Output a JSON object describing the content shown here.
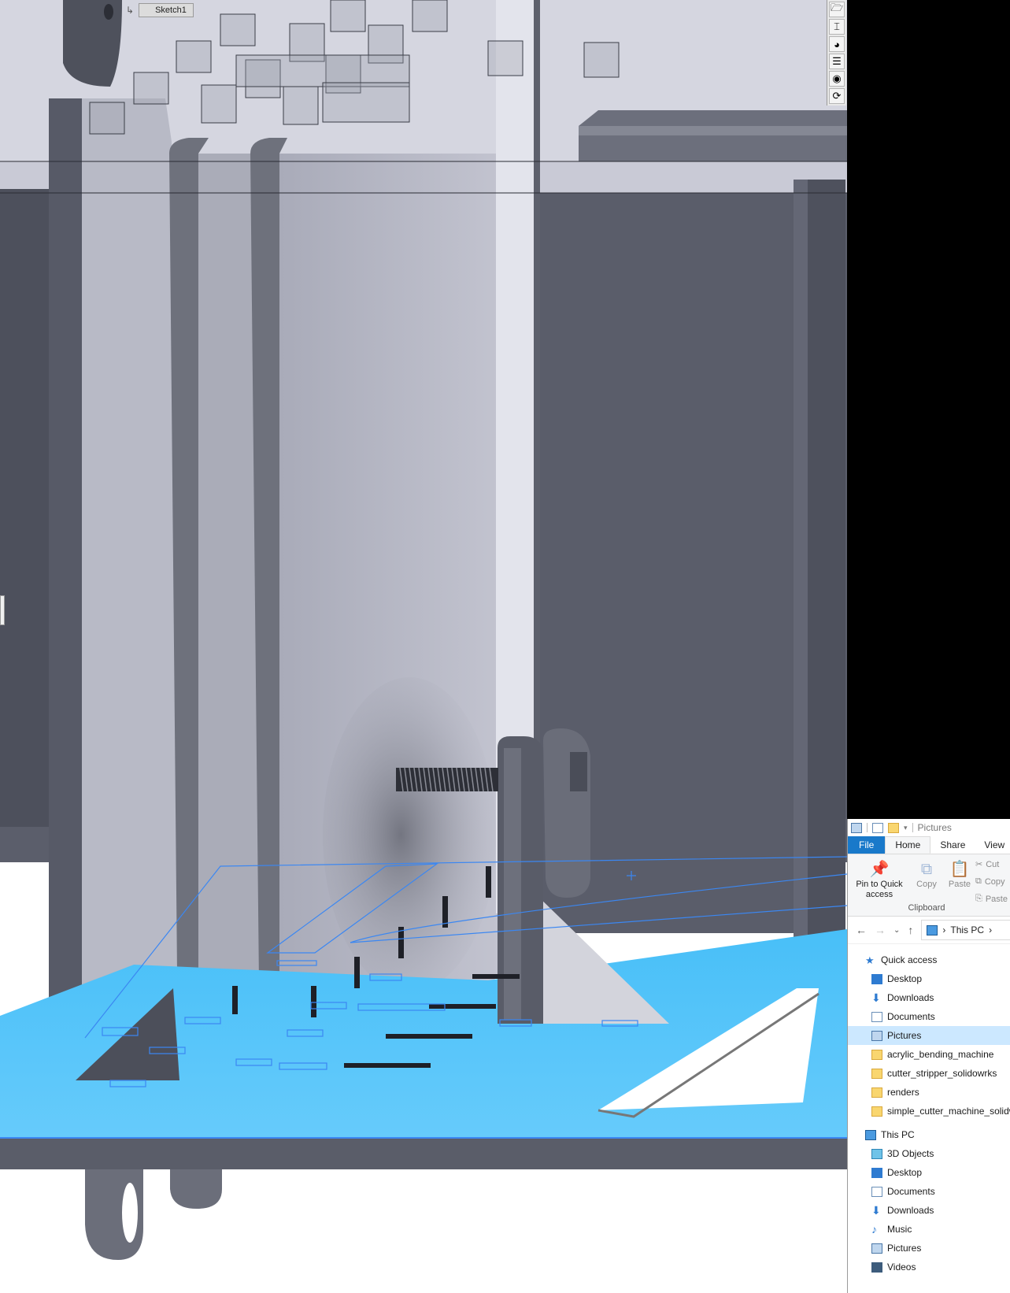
{
  "cad": {
    "sketch_label": "Sketch1",
    "colors": {
      "background": "#ffffff",
      "panel_dark": "#5a5d6a",
      "panel_mid": "#6e717e",
      "panel_light": "#b9bbc8",
      "sketch_line": "#3b87f2",
      "selected_face": "#5ac6fb"
    },
    "view_toolbar": [
      {
        "icon": "folder-open-icon",
        "glyph": "🗁"
      },
      {
        "icon": "dimension-icon",
        "glyph": "⌶"
      },
      {
        "icon": "appearance-icon",
        "glyph": "◕"
      },
      {
        "icon": "property-list-icon",
        "glyph": "☰"
      },
      {
        "icon": "view-orientation-icon",
        "glyph": "◉"
      },
      {
        "icon": "rebuild-icon",
        "glyph": "⟳"
      }
    ]
  },
  "explorer": {
    "title": "Pictures",
    "tabs": [
      {
        "label": "File",
        "kind": "file"
      },
      {
        "label": "Home",
        "kind": "active"
      },
      {
        "label": "Share",
        "kind": "normal"
      },
      {
        "label": "View",
        "kind": "normal"
      }
    ],
    "ribbon": {
      "pin_label": "Pin to Quick access",
      "copy_label": "Copy",
      "paste_label": "Paste",
      "cut_label": "Cut",
      "copy2_label": "Copy",
      "paste2_label": "Paste",
      "group_label": "Clipboard"
    },
    "address": {
      "root": "This PC",
      "sep": "›"
    },
    "quick_access_label": "Quick access",
    "quick_items": [
      {
        "label": "Desktop",
        "icon": "desktop-icon",
        "type": "blue"
      },
      {
        "label": "Downloads",
        "icon": "downloads-icon",
        "type": "down"
      },
      {
        "label": "Documents",
        "icon": "documents-icon",
        "type": "doc"
      },
      {
        "label": "Pictures",
        "icon": "pictures-icon",
        "type": "pic",
        "selected": true
      },
      {
        "label": "acrylic_bending_machine",
        "icon": "folder-icon",
        "type": "folder"
      },
      {
        "label": "cutter_stripper_solidowrks",
        "icon": "folder-icon",
        "type": "folder"
      },
      {
        "label": "renders",
        "icon": "folder-icon",
        "type": "folder"
      },
      {
        "label": "simple_cutter_machine_solidw",
        "icon": "folder-icon",
        "type": "folder"
      }
    ],
    "this_pc_label": "This PC",
    "pc_items": [
      {
        "label": "3D Objects",
        "icon": "3d-objects-icon",
        "type": "cube"
      },
      {
        "label": "Desktop",
        "icon": "desktop-icon",
        "type": "blue"
      },
      {
        "label": "Documents",
        "icon": "documents-icon",
        "type": "doc"
      },
      {
        "label": "Downloads",
        "icon": "downloads-icon",
        "type": "down"
      },
      {
        "label": "Music",
        "icon": "music-icon",
        "type": "music"
      },
      {
        "label": "Pictures",
        "icon": "pictures-icon",
        "type": "pic"
      },
      {
        "label": "Videos",
        "icon": "videos-icon",
        "type": "vid"
      }
    ]
  }
}
